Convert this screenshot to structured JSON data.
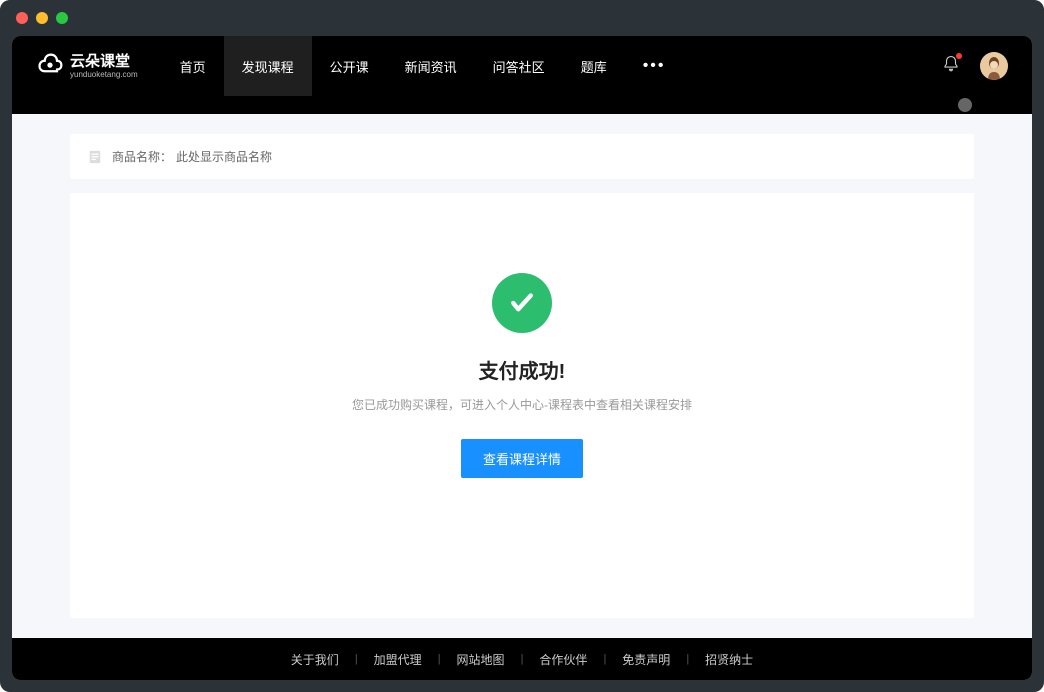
{
  "logo": {
    "main": "云朵课堂",
    "sub": "yunduoketang.com"
  },
  "nav": {
    "items": [
      {
        "label": "首页",
        "active": false
      },
      {
        "label": "发现课程",
        "active": true
      },
      {
        "label": "公开课",
        "active": false
      },
      {
        "label": "新闻资讯",
        "active": false
      },
      {
        "label": "问答社区",
        "active": false
      },
      {
        "label": "题库",
        "active": false
      }
    ]
  },
  "product": {
    "label": "商品名称：",
    "value": "此处显示商品名称"
  },
  "success": {
    "title": "支付成功!",
    "desc": "您已成功购买课程，可进入个人中心-课程表中查看相关课程安排",
    "button": "查看课程详情"
  },
  "footer": {
    "links": [
      "关于我们",
      "加盟代理",
      "网站地图",
      "合作伙伴",
      "免责声明",
      "招贤纳士"
    ]
  }
}
